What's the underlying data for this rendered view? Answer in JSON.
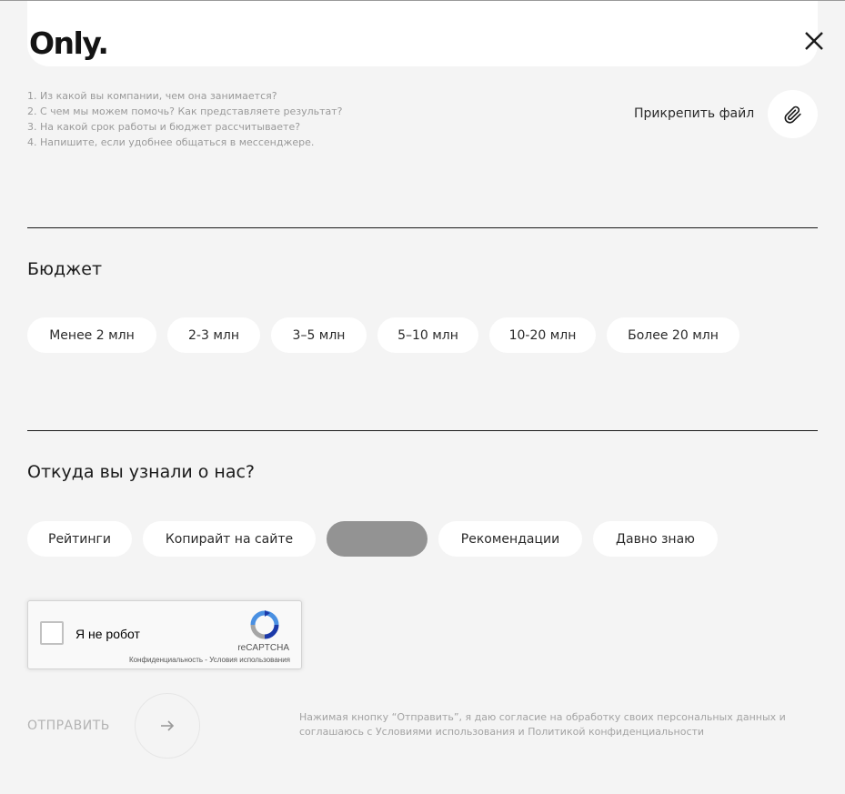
{
  "header": {
    "logo": "Only."
  },
  "message_hints": [
    "1. Из какой вы компании, чем она занимается?",
    "2. С чем мы можем помочь? Как представляете результат?",
    "3. На какой срок работы и бюджет рассчитываете?",
    "4. Напишите, если удобнее общаться в мессенджере."
  ],
  "attach": {
    "label": "Прикрепить файл"
  },
  "budget": {
    "title": "Бюджет",
    "options": [
      "Менее 2 млн",
      "2-3 млн",
      "3–5 млн",
      "5–10 млн",
      "10-20 млн",
      "Более 20 млн"
    ]
  },
  "source": {
    "title": "Откуда вы узнали о нас?",
    "options": [
      "Рейтинги",
      "Копирайт на сайте",
      "",
      "Рекомендации",
      "Давно знаю"
    ]
  },
  "recaptcha": {
    "label": "Я не робот",
    "brand": "reCAPTCHA",
    "links": "Конфиденциальность - Условия использования"
  },
  "submit": {
    "label": "ОТПРАВИТЬ"
  },
  "consent": "Нажимая кнопку “Отправить”, я даю согласие на обработку своих персональных данных и соглашаюсь с Условиями использования и Политикой конфиденциальности",
  "colors": {
    "background": "#f4f4f4",
    "chip": "#ffffff",
    "chip_selected": "#939393",
    "text": "#1a1a1a"
  }
}
